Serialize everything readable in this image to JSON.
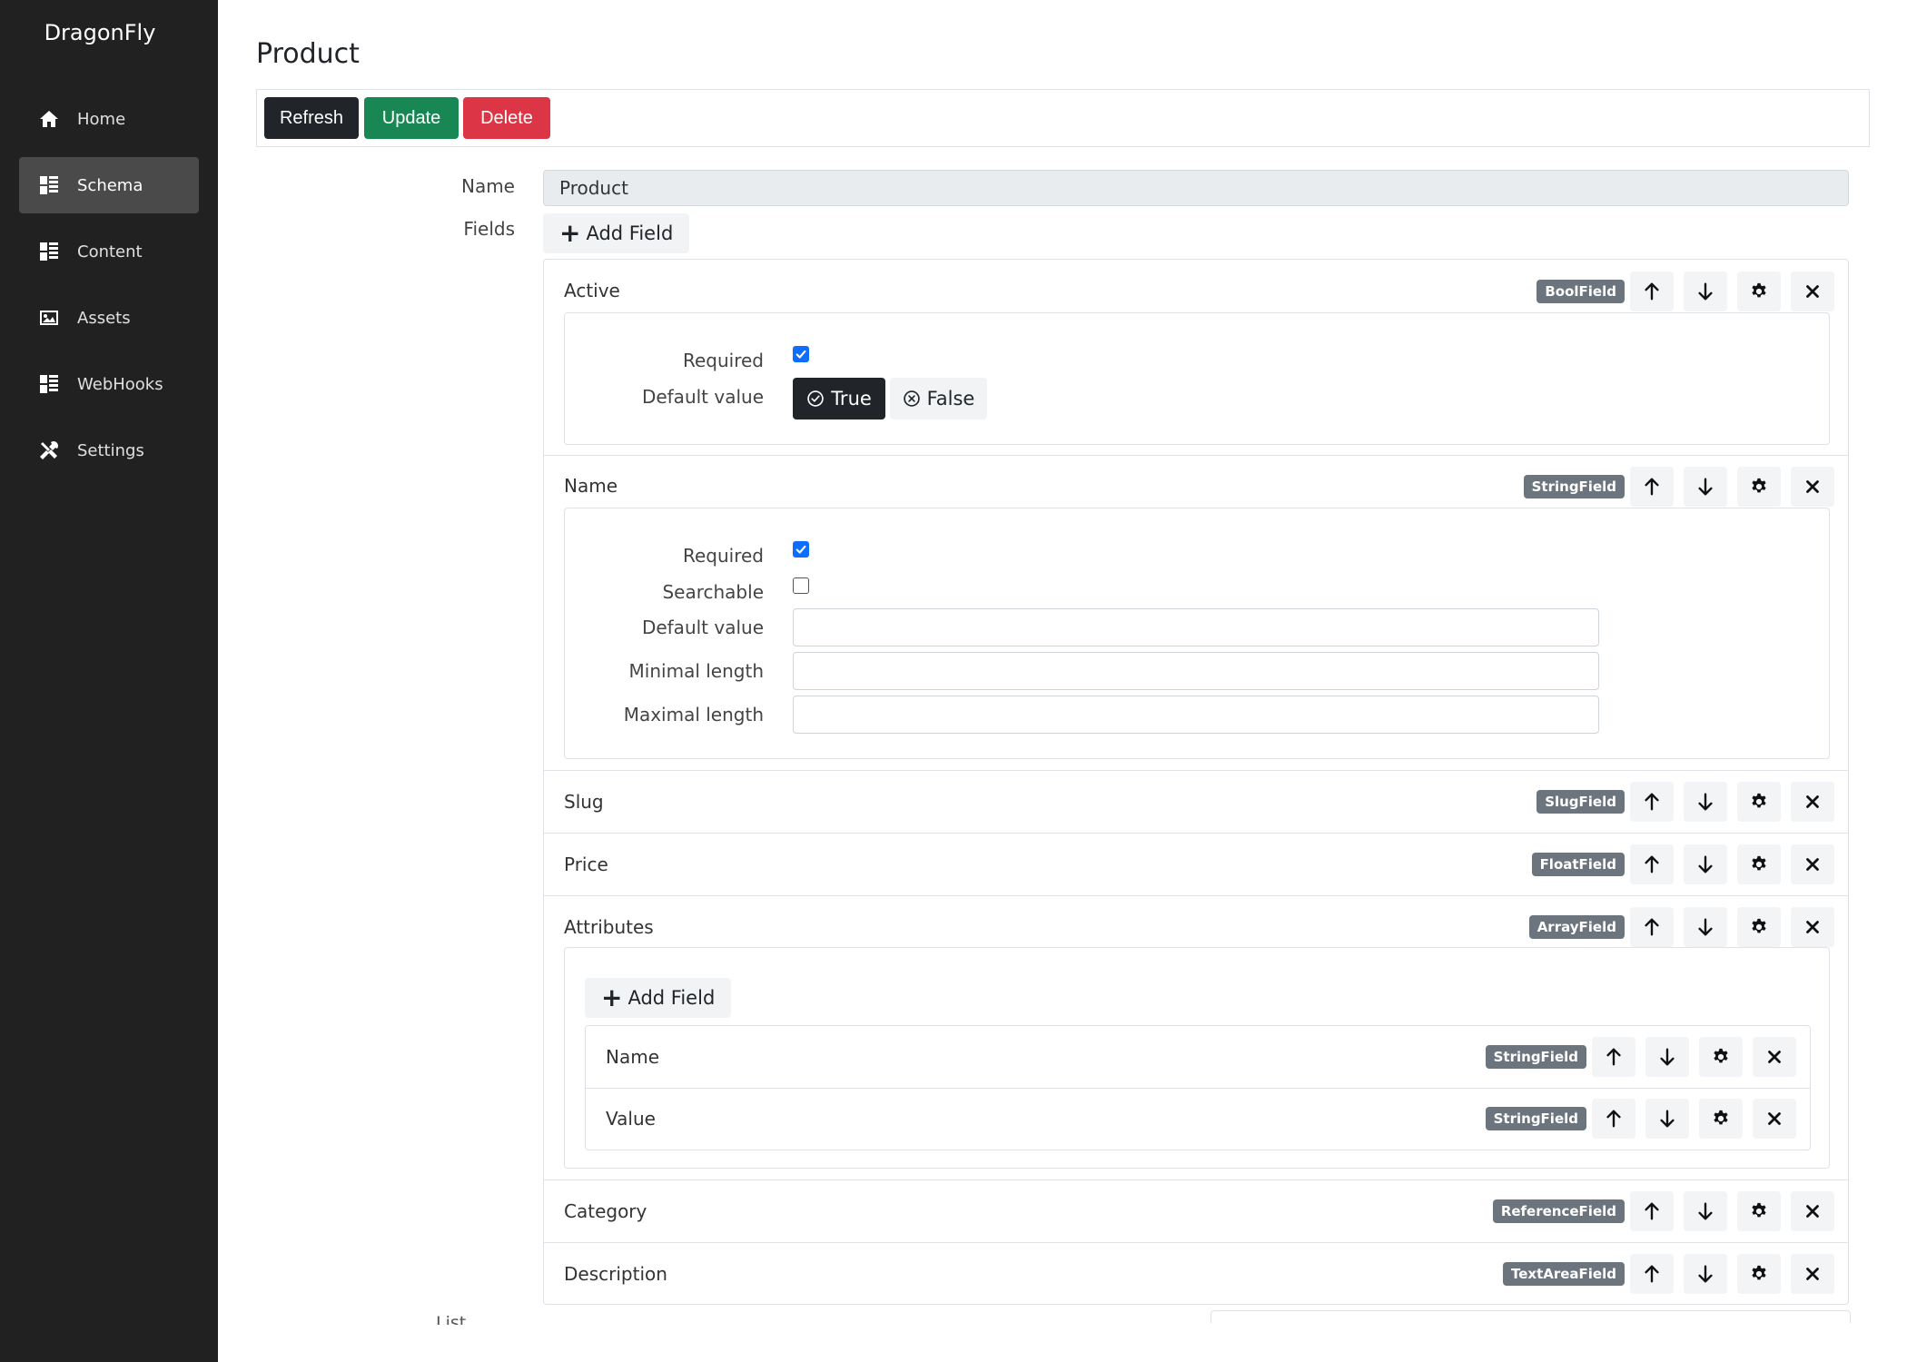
{
  "app": {
    "brand": "DragonFly"
  },
  "sidebar": {
    "items": [
      {
        "label": "Home",
        "icon": "home-icon",
        "active": false
      },
      {
        "label": "Schema",
        "icon": "list-icon",
        "active": true
      },
      {
        "label": "Content",
        "icon": "list-icon",
        "active": false
      },
      {
        "label": "Assets",
        "icon": "image-icon",
        "active": false
      },
      {
        "label": "WebHooks",
        "icon": "list-icon",
        "active": false
      },
      {
        "label": "Settings",
        "icon": "tools-icon",
        "active": false
      }
    ]
  },
  "page": {
    "title": "Product"
  },
  "toolbar": {
    "refresh": "Refresh",
    "update": "Update",
    "delete": "Delete"
  },
  "form": {
    "name_label": "Name",
    "name_value": "Product",
    "fields_label": "Fields",
    "add_field": "Add Field",
    "list_fields_label": "List fields"
  },
  "fields": [
    {
      "name": "Active",
      "type": "BoolField"
    },
    {
      "name": "Name",
      "type": "StringField"
    },
    {
      "name": "Slug",
      "type": "SlugField"
    },
    {
      "name": "Price",
      "type": "FloatField"
    },
    {
      "name": "Attributes",
      "type": "ArrayField"
    },
    {
      "name": "Category",
      "type": "ReferenceField"
    },
    {
      "name": "Description",
      "type": "TextAreaField"
    }
  ],
  "active_field": {
    "required_label": "Required",
    "required": true,
    "default_label": "Default value",
    "true_label": "True",
    "false_label": "False",
    "default_selected": "True"
  },
  "name_field": {
    "required_label": "Required",
    "required": true,
    "searchable_label": "Searchable",
    "searchable": false,
    "default_label": "Default value",
    "min_label": "Minimal length",
    "max_label": "Maximal length"
  },
  "attributes_field": {
    "add_field": "Add Field",
    "subfields": [
      {
        "name": "Name",
        "type": "StringField"
      },
      {
        "name": "Value",
        "type": "StringField"
      }
    ]
  },
  "colors": {
    "sidebar_bg": "#212121",
    "refresh": "#212529",
    "update": "#198754",
    "delete": "#dc3545",
    "badge": "#6c757d",
    "checkbox": "#0d6efd"
  }
}
